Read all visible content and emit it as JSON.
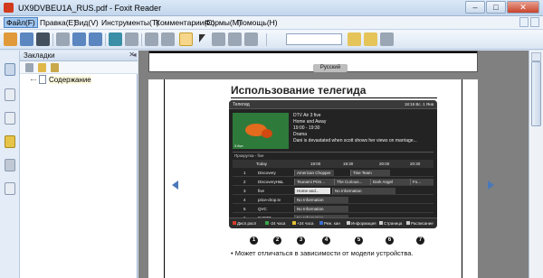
{
  "window": {
    "title": "UX9DVBEU1A_RUS.pdf - Foxit Reader",
    "min": "–",
    "max": "□",
    "close": "✕"
  },
  "menu": [
    "Файл(F)",
    "Правка(E)",
    "Вид(V)",
    "Инструменты(T)",
    "Комментарии(C)",
    "Формы(M)",
    "Помощь(H)"
  ],
  "panel": {
    "title": "Закладки",
    "close": "✕",
    "collapse": "◄",
    "bookmark": "Содержание"
  },
  "document": {
    "prev_page_label": "Русский",
    "heading": "Использование телегида",
    "note": "• Может отличаться в зависимости от модели устройства.",
    "tv": {
      "title": "Телегид",
      "clock": "18:15 Вс. 1 Янв",
      "info": [
        "DTV Air 3 five",
        "Home and Away",
        "19:00 - 19:30",
        "Drama",
        "Dani is devastated when scott shows her views on marriage..."
      ],
      "preview_tag": "3 five",
      "channel_header": "Прокрутка - five",
      "timeline": [
        "Today",
        "19:00",
        "19:30",
        "20:00",
        "20:30"
      ],
      "rows": [
        {
          "num": "1",
          "name": "Discovery",
          "progs": [
            "American Chopper",
            "Tine Team"
          ]
        },
        {
          "num": "2",
          "name": "DiscoveryH&L",
          "progs": [
            "Tsunami Prim...",
            "The Curious...",
            "Dark Angel",
            "Fo..."
          ]
        },
        {
          "num": "3",
          "name": "five",
          "progs": [
            "Home and...",
            "No Information"
          ]
        },
        {
          "num": "4",
          "name": "price-drop.tv",
          "progs": [
            "No Information"
          ]
        },
        {
          "num": "5",
          "name": "QVC",
          "progs": [
            "No Information"
          ]
        },
        {
          "num": "6",
          "name": "R4DTT",
          "progs": [
            "No Information"
          ]
        }
      ],
      "legend": [
        "Дисп.расп",
        "-24 часа",
        "+24 часа",
        "Реж. кан",
        "Информация",
        "Страница",
        "Расписание"
      ]
    },
    "callouts": [
      "1",
      "2",
      "3",
      "4",
      "5",
      "6",
      "7"
    ]
  }
}
